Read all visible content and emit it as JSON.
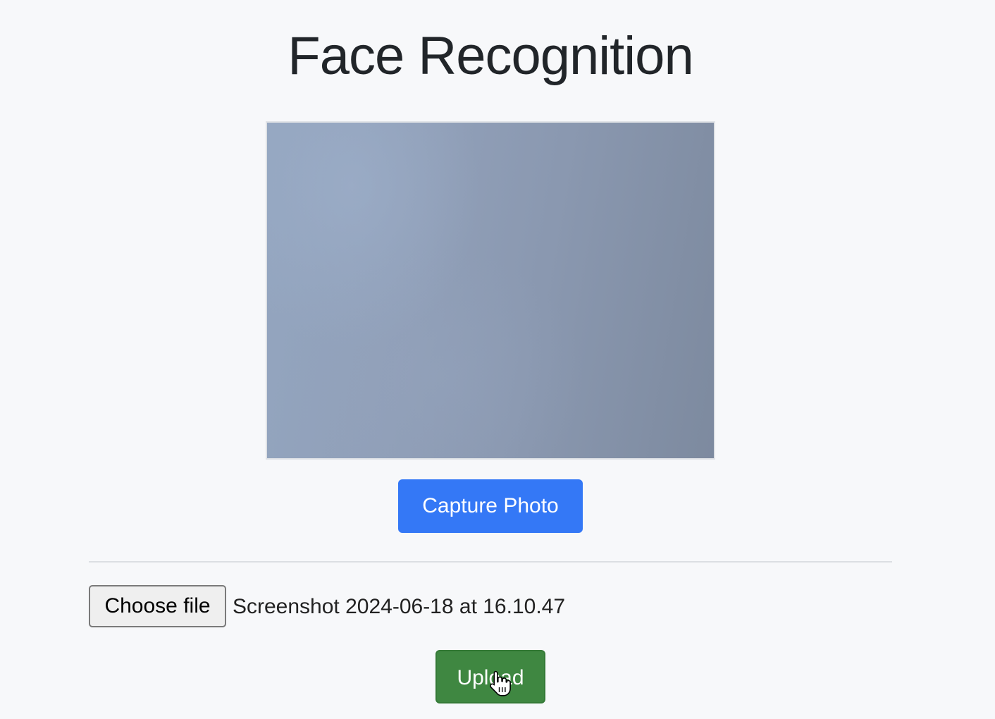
{
  "page": {
    "title": "Face Recognition"
  },
  "camera": {
    "capture_label": "Capture Photo"
  },
  "upload": {
    "choose_file_label": "Choose file",
    "selected_file_name": "Screenshot 2024-06-18 at 16.10.47",
    "upload_label": "Upload"
  },
  "colors": {
    "background": "#f7f8fa",
    "capture_button": "#3478f6",
    "upload_button": "#3f8741"
  },
  "icons": {
    "cursor": "hand-pointer-icon"
  }
}
